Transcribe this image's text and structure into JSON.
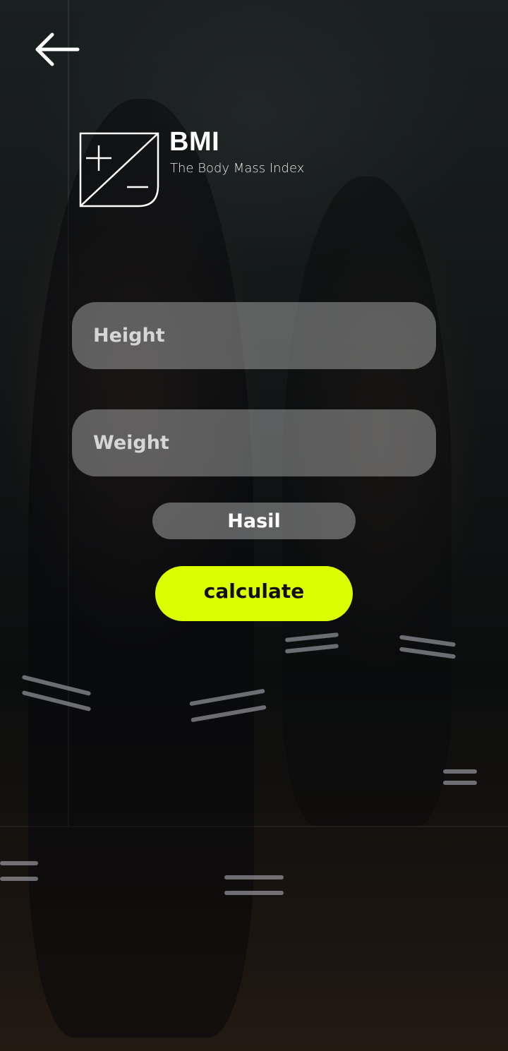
{
  "header": {
    "back_icon": "arrow-left-icon"
  },
  "logo": {
    "icon": "plus-minus-icon",
    "title": "BMI",
    "subtitle": "The Body Mass Index"
  },
  "form": {
    "height_placeholder": "Height",
    "height_value": "",
    "weight_placeholder": "Weight",
    "weight_value": ""
  },
  "result": {
    "label": "Hasil"
  },
  "actions": {
    "calculate_label": "calculate"
  },
  "colors": {
    "accent": "#dbff00",
    "field_bg": "rgba(200,200,200,0.42)",
    "text": "#ffffff"
  }
}
